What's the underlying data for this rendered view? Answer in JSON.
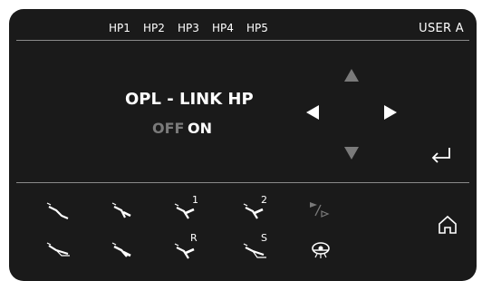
{
  "header": {
    "hp_tabs": [
      "HP1",
      "HP2",
      "HP3",
      "HP4",
      "HP5"
    ],
    "user": "USER A"
  },
  "main": {
    "title": "OPL - LINK HP",
    "off_label": "OFF",
    "on_label": "ON",
    "selected": "ON"
  },
  "nav": [
    "up-arrow-icon",
    "left-arrow-icon",
    "right-arrow-icon",
    "down-arrow-icon",
    "enter-icon"
  ],
  "tools_row1": [
    {
      "icon": "instrument-handpiece-icon",
      "label": ""
    },
    {
      "icon": "instrument-handpiece-icon",
      "label": ""
    },
    {
      "icon": "instrument-handpiece-icon",
      "label": "1"
    },
    {
      "icon": "instrument-handpiece-icon",
      "label": "2"
    },
    {
      "icon": "play-toggle-icon",
      "label": ""
    }
  ],
  "tools_row2": [
    {
      "icon": "instrument-handpiece-icon",
      "label": ""
    },
    {
      "icon": "instrument-handpiece-icon",
      "label": ""
    },
    {
      "icon": "instrument-handpiece-icon",
      "label": "R"
    },
    {
      "icon": "instrument-handpiece-icon",
      "label": "S"
    },
    {
      "icon": "operating-light-icon",
      "label": ""
    }
  ],
  "colors": {
    "panel": "#1a1a1a",
    "text": "#ffffff",
    "dim": "#7a7a7a",
    "divider": "#8a8a8a"
  }
}
